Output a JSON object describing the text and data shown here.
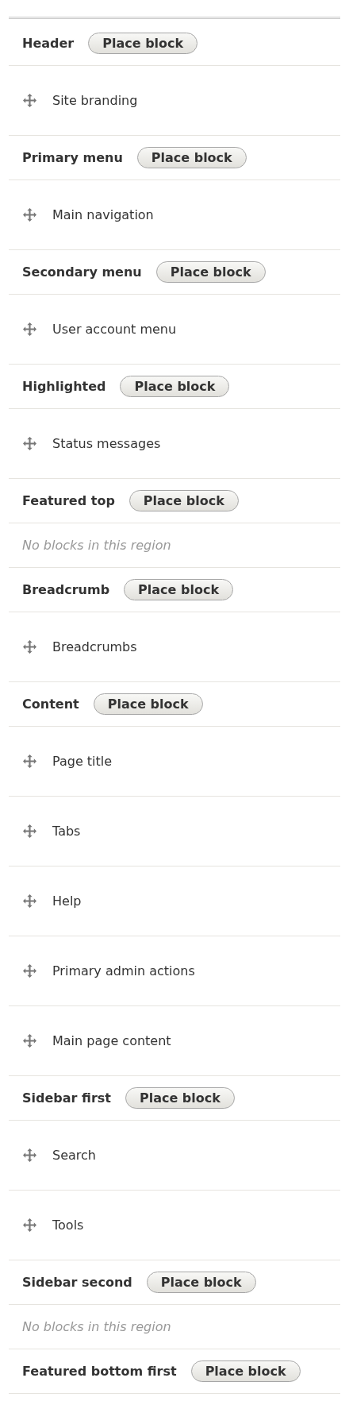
{
  "regions": [
    {
      "name": "Header",
      "button": "Place block",
      "blocks": [
        "Site branding"
      ]
    },
    {
      "name": "Primary menu",
      "button": "Place block",
      "blocks": [
        "Main navigation"
      ]
    },
    {
      "name": "Secondary menu",
      "button": "Place block",
      "blocks": [
        "User account menu"
      ]
    },
    {
      "name": "Highlighted",
      "button": "Place block",
      "blocks": [
        "Status messages"
      ]
    },
    {
      "name": "Featured top",
      "button": "Place block",
      "empty_text": "No blocks in this region"
    },
    {
      "name": "Breadcrumb",
      "button": "Place block",
      "blocks": [
        "Breadcrumbs"
      ]
    },
    {
      "name": "Content",
      "button": "Place block",
      "blocks": [
        "Page title",
        "Tabs",
        "Help",
        "Primary admin actions",
        "Main page content"
      ]
    },
    {
      "name": "Sidebar first",
      "button": "Place block",
      "blocks": [
        "Search",
        "Tools"
      ]
    },
    {
      "name": "Sidebar second",
      "button": "Place block",
      "empty_text": "No blocks in this region"
    },
    {
      "name": "Featured bottom first",
      "button": "Place block"
    }
  ]
}
